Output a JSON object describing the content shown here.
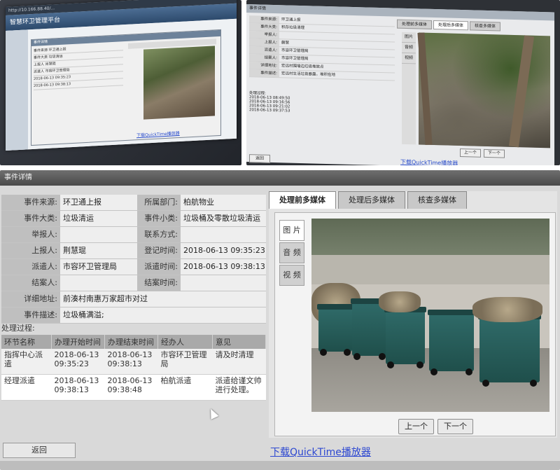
{
  "top_left": {
    "app_title": "智慧环卫管理平台",
    "url_text": "http://10.166.88.40/...",
    "dialog_title": "事件详情",
    "rows": [
      "事件来源  环卫通上报",
      "事件大类  垃圾清运",
      "上报人  肖慧琨",
      "派遣人  市容环卫管理局",
      "2018-06-13 09:35:23",
      "2018-06-13 09:38:13"
    ],
    "link": "下载QuickTime播放器"
  },
  "top_right": {
    "dialog_title": "事件详情",
    "rows": [
      {
        "k": "事件来源:",
        "v": "环卫通上报"
      },
      {
        "k": "事件大类:",
        "v": "积存垃圾清理"
      },
      {
        "k": "举报人:",
        "v": ""
      },
      {
        "k": "上报人:",
        "v": "蒯慧"
      },
      {
        "k": "派遣人:",
        "v": "市容环卫管理局"
      },
      {
        "k": "结案人:",
        "v": "市容环卫管理局"
      },
      {
        "k": "详细地址:",
        "v": "宏远村围墙边垃圾堆放点"
      },
      {
        "k": "事件描述:",
        "v": "宏远村生活垃圾暴露，堆积在地"
      }
    ],
    "proc_label": "处理过程:",
    "proc_rows": [
      "2018-06-13 08:49:50",
      "2018-06-13 09:16:56",
      "2018-06-13 09:21:02",
      "2018-06-13 09:37:53"
    ],
    "tabs": [
      "处理前多媒体",
      "处理后多媒体",
      "核查多媒体"
    ],
    "side": [
      "图片",
      "音频",
      "视频"
    ],
    "prev": "上一个",
    "next": "下一个",
    "back": "返回",
    "link": "下载QuickTime播放器"
  },
  "main": {
    "window_title": "事件详情",
    "fields": {
      "source_label": "事件来源:",
      "source": "环卫通上报",
      "dept_label": "所属部门:",
      "dept": "柏航物业",
      "cat_label": "事件大类:",
      "cat": "垃圾清运",
      "subcat_label": "事件小类:",
      "subcat": "垃圾桶及零散垃圾清运",
      "reporter_label": "举报人:",
      "reporter": "",
      "contact_label": "联系方式:",
      "contact": "",
      "submitter_label": "上报人:",
      "submitter": "荆慧琨",
      "regtime_label": "登记时间:",
      "regtime": "2018-06-13 09:35:23",
      "dispatcher_label": "派遣人:",
      "dispatcher": "市容环卫管理局",
      "dispatchtime_label": "派遣时间:",
      "dispatchtime": "2018-06-13 09:38:13",
      "closer_label": "结案人:",
      "closer": "",
      "closetime_label": "结案时间:",
      "closetime": "",
      "address_label": "详细地址:",
      "address": "前湊村南惠万家超市对过",
      "desc_label": "事件描述:",
      "desc": "垃圾桶满溢;"
    },
    "process_label": "处理过程:",
    "process_headers": [
      "环节名称",
      "办理开始时间",
      "办理结束时间",
      "经办人",
      "意见"
    ],
    "process_rows": [
      {
        "step": "指挥中心派遣",
        "start": "2018-06-13 09:35:23",
        "end": "2018-06-13 09:38:13",
        "handler": "市容环卫管理局",
        "opinion": "请及时清理"
      },
      {
        "step": "经理派遣",
        "start": "2018-06-13 09:38:13",
        "end": "2018-06-13 09:38:48",
        "handler": "柏航派遣",
        "opinion": "派遣给谨文帅进行处理。"
      }
    ],
    "tabs": [
      "处理前多媒体",
      "处理后多媒体",
      "核查多媒体"
    ],
    "media_side": [
      "图 片",
      "音 频",
      "视 频"
    ],
    "prev_button": "上一个",
    "next_button": "下一个",
    "back_button": "返回",
    "quicktime_link": "下载QuickTime播放器"
  }
}
